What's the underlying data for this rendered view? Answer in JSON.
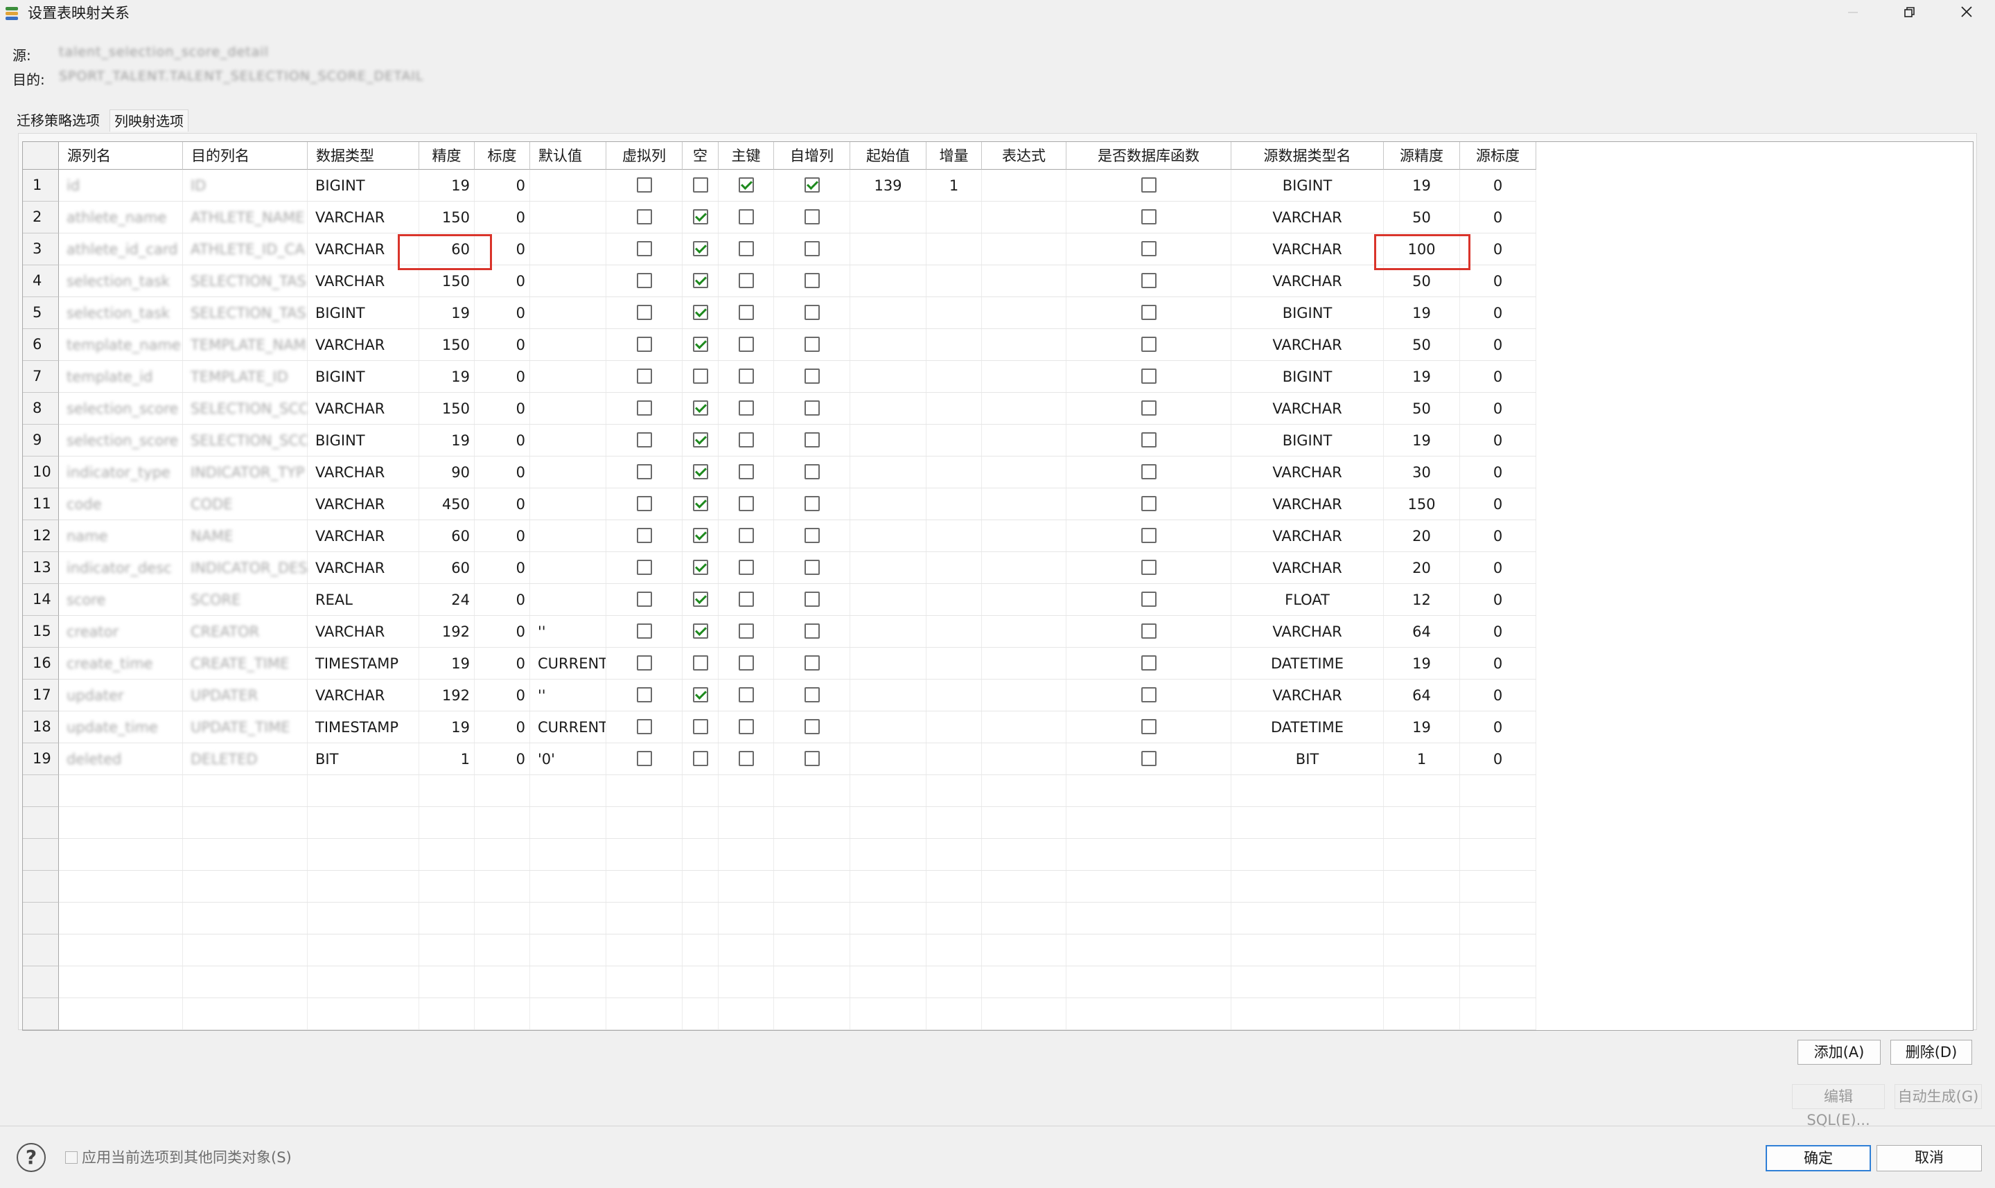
{
  "window": {
    "title": "设置表映射关系",
    "minimize_icon": "minimize-icon",
    "restore_icon": "restore-icon",
    "close_icon": "close-icon"
  },
  "meta": {
    "source_label": "源:",
    "source_value": "talent_selection_score_detail",
    "dest_label": "目的:",
    "dest_value": "SPORT_TALENT.TALENT_SELECTION_SCORE_DETAIL"
  },
  "tabs": [
    "迁移策略选项",
    "列映射选项"
  ],
  "table": {
    "headers": [
      "源列名",
      "目的列名",
      "数据类型",
      "精度",
      "标度",
      "默认值",
      "虚拟列",
      "空",
      "主键",
      "自增列",
      "起始值",
      "增量",
      "表达式",
      "是否数据库函数",
      "源数据类型名",
      "源精度",
      "源标度"
    ],
    "rows": [
      {
        "no": "1",
        "src": "id",
        "dst": "ID",
        "type": "BIGINT",
        "precision": "19",
        "scale": "0",
        "default": "",
        "virtual": false,
        "nullable": false,
        "pk": true,
        "autoinc": true,
        "start": "139",
        "step": "1",
        "expr": "",
        "dbfunc": false,
        "srctype": "BIGINT",
        "srcprec": "19",
        "srcscale": "0"
      },
      {
        "no": "2",
        "src": "athlete_name",
        "dst": "ATHLETE_NAME",
        "type": "VARCHAR",
        "precision": "150",
        "scale": "0",
        "default": "",
        "virtual": false,
        "nullable": true,
        "pk": false,
        "autoinc": false,
        "start": "",
        "step": "",
        "expr": "",
        "dbfunc": false,
        "srctype": "VARCHAR",
        "srcprec": "50",
        "srcscale": "0"
      },
      {
        "no": "3",
        "src": "athlete_id_card",
        "dst": "ATHLETE_ID_CA",
        "type": "VARCHAR",
        "precision": "60",
        "scale": "0",
        "default": "",
        "virtual": false,
        "nullable": true,
        "pk": false,
        "autoinc": false,
        "start": "",
        "step": "",
        "expr": "",
        "dbfunc": false,
        "srctype": "VARCHAR",
        "srcprec": "100",
        "srcscale": "0"
      },
      {
        "no": "4",
        "src": "selection_task",
        "dst": "SELECTION_TAS",
        "type": "VARCHAR",
        "precision": "150",
        "scale": "0",
        "default": "",
        "virtual": false,
        "nullable": true,
        "pk": false,
        "autoinc": false,
        "start": "",
        "step": "",
        "expr": "",
        "dbfunc": false,
        "srctype": "VARCHAR",
        "srcprec": "50",
        "srcscale": "0"
      },
      {
        "no": "5",
        "src": "selection_task",
        "dst": "SELECTION_TAS",
        "type": "BIGINT",
        "precision": "19",
        "scale": "0",
        "default": "",
        "virtual": false,
        "nullable": true,
        "pk": false,
        "autoinc": false,
        "start": "",
        "step": "",
        "expr": "",
        "dbfunc": false,
        "srctype": "BIGINT",
        "srcprec": "19",
        "srcscale": "0"
      },
      {
        "no": "6",
        "src": "template_name",
        "dst": "TEMPLATE_NAM",
        "type": "VARCHAR",
        "precision": "150",
        "scale": "0",
        "default": "",
        "virtual": false,
        "nullable": true,
        "pk": false,
        "autoinc": false,
        "start": "",
        "step": "",
        "expr": "",
        "dbfunc": false,
        "srctype": "VARCHAR",
        "srcprec": "50",
        "srcscale": "0"
      },
      {
        "no": "7",
        "src": "template_id",
        "dst": "TEMPLATE_ID",
        "type": "BIGINT",
        "precision": "19",
        "scale": "0",
        "default": "",
        "virtual": false,
        "nullable": false,
        "pk": false,
        "autoinc": false,
        "start": "",
        "step": "",
        "expr": "",
        "dbfunc": false,
        "srctype": "BIGINT",
        "srcprec": "19",
        "srcscale": "0"
      },
      {
        "no": "8",
        "src": "selection_score",
        "dst": "SELECTION_SCO",
        "type": "VARCHAR",
        "precision": "150",
        "scale": "0",
        "default": "",
        "virtual": false,
        "nullable": true,
        "pk": false,
        "autoinc": false,
        "start": "",
        "step": "",
        "expr": "",
        "dbfunc": false,
        "srctype": "VARCHAR",
        "srcprec": "50",
        "srcscale": "0"
      },
      {
        "no": "9",
        "src": "selection_score",
        "dst": "SELECTION_SCO",
        "type": "BIGINT",
        "precision": "19",
        "scale": "0",
        "default": "",
        "virtual": false,
        "nullable": true,
        "pk": false,
        "autoinc": false,
        "start": "",
        "step": "",
        "expr": "",
        "dbfunc": false,
        "srctype": "BIGINT",
        "srcprec": "19",
        "srcscale": "0"
      },
      {
        "no": "10",
        "src": "indicator_type",
        "dst": "INDICATOR_TYP",
        "type": "VARCHAR",
        "precision": "90",
        "scale": "0",
        "default": "",
        "virtual": false,
        "nullable": true,
        "pk": false,
        "autoinc": false,
        "start": "",
        "step": "",
        "expr": "",
        "dbfunc": false,
        "srctype": "VARCHAR",
        "srcprec": "30",
        "srcscale": "0"
      },
      {
        "no": "11",
        "src": "code",
        "dst": "CODE",
        "type": "VARCHAR",
        "precision": "450",
        "scale": "0",
        "default": "",
        "virtual": false,
        "nullable": true,
        "pk": false,
        "autoinc": false,
        "start": "",
        "step": "",
        "expr": "",
        "dbfunc": false,
        "srctype": "VARCHAR",
        "srcprec": "150",
        "srcscale": "0"
      },
      {
        "no": "12",
        "src": "name",
        "dst": "NAME",
        "type": "VARCHAR",
        "precision": "60",
        "scale": "0",
        "default": "",
        "virtual": false,
        "nullable": true,
        "pk": false,
        "autoinc": false,
        "start": "",
        "step": "",
        "expr": "",
        "dbfunc": false,
        "srctype": "VARCHAR",
        "srcprec": "20",
        "srcscale": "0"
      },
      {
        "no": "13",
        "src": "indicator_desc",
        "dst": "INDICATOR_DES",
        "type": "VARCHAR",
        "precision": "60",
        "scale": "0",
        "default": "",
        "virtual": false,
        "nullable": true,
        "pk": false,
        "autoinc": false,
        "start": "",
        "step": "",
        "expr": "",
        "dbfunc": false,
        "srctype": "VARCHAR",
        "srcprec": "20",
        "srcscale": "0"
      },
      {
        "no": "14",
        "src": "score",
        "dst": "SCORE",
        "type": "REAL",
        "precision": "24",
        "scale": "0",
        "default": "",
        "virtual": false,
        "nullable": true,
        "pk": false,
        "autoinc": false,
        "start": "",
        "step": "",
        "expr": "",
        "dbfunc": false,
        "srctype": "FLOAT",
        "srcprec": "12",
        "srcscale": "0"
      },
      {
        "no": "15",
        "src": "creator",
        "dst": "CREATOR",
        "type": "VARCHAR",
        "precision": "192",
        "scale": "0",
        "default": "''",
        "virtual": false,
        "nullable": true,
        "pk": false,
        "autoinc": false,
        "start": "",
        "step": "",
        "expr": "",
        "dbfunc": false,
        "srctype": "VARCHAR",
        "srcprec": "64",
        "srcscale": "0"
      },
      {
        "no": "16",
        "src": "create_time",
        "dst": "CREATE_TIME",
        "type": "TIMESTAMP",
        "precision": "19",
        "scale": "0",
        "default": "CURRENT.",
        "virtual": false,
        "nullable": false,
        "pk": false,
        "autoinc": false,
        "start": "",
        "step": "",
        "expr": "",
        "dbfunc": false,
        "srctype": "DATETIME",
        "srcprec": "19",
        "srcscale": "0"
      },
      {
        "no": "17",
        "src": "updater",
        "dst": "UPDATER",
        "type": "VARCHAR",
        "precision": "192",
        "scale": "0",
        "default": "''",
        "virtual": false,
        "nullable": true,
        "pk": false,
        "autoinc": false,
        "start": "",
        "step": "",
        "expr": "",
        "dbfunc": false,
        "srctype": "VARCHAR",
        "srcprec": "64",
        "srcscale": "0"
      },
      {
        "no": "18",
        "src": "update_time",
        "dst": "UPDATE_TIME",
        "type": "TIMESTAMP",
        "precision": "19",
        "scale": "0",
        "default": "CURRENT.",
        "virtual": false,
        "nullable": false,
        "pk": false,
        "autoinc": false,
        "start": "",
        "step": "",
        "expr": "",
        "dbfunc": false,
        "srctype": "DATETIME",
        "srcprec": "19",
        "srcscale": "0"
      },
      {
        "no": "19",
        "src": "deleted",
        "dst": "DELETED",
        "type": "BIT",
        "precision": "1",
        "scale": "0",
        "default": "'0'",
        "virtual": false,
        "nullable": false,
        "pk": false,
        "autoinc": false,
        "start": "",
        "step": "",
        "expr": "",
        "dbfunc": false,
        "srctype": "BIT",
        "srcprec": "1",
        "srcscale": "0"
      }
    ]
  },
  "buttons": {
    "add": "添加(A)",
    "delete": "删除(D)",
    "edit_sql": "编辑SQL(E)...",
    "auto_generate": "自动生成(G)",
    "ok": "确定",
    "cancel": "取消"
  },
  "footer": {
    "help_icon": "help-icon",
    "apply_label": "应用当前选项到其他同类对象(S)",
    "apply_checked": false
  },
  "colors": {
    "highlight_border": "#d9342b",
    "check_mark": "#1e8a1e",
    "primary_border": "#2f7fd6"
  }
}
